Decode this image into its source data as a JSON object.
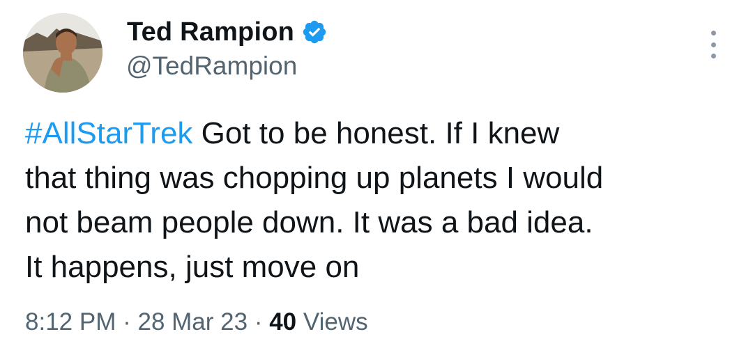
{
  "author": {
    "display_name": "Ted Rampion",
    "handle": "@TedRampion",
    "verified": true
  },
  "tweet": {
    "hashtag": "#AllStarTrek",
    "line1_rest": " Got to be honest. If I knew",
    "line2": "that thing was chopping up planets I would",
    "line3": "not beam people down. It was a bad idea.",
    "line4": "It happens, just move on"
  },
  "meta": {
    "time": "8:12 PM",
    "separator": "·",
    "date": "28 Mar 23",
    "views_count": "40",
    "views_label": "Views"
  },
  "icons": {
    "verified": "verified-badge-icon",
    "more": "more-options-icon"
  },
  "colors": {
    "link": "#1d9bf0",
    "verified": "#1d9bf0",
    "secondary_text": "#536471",
    "primary_text": "#0f1419"
  }
}
